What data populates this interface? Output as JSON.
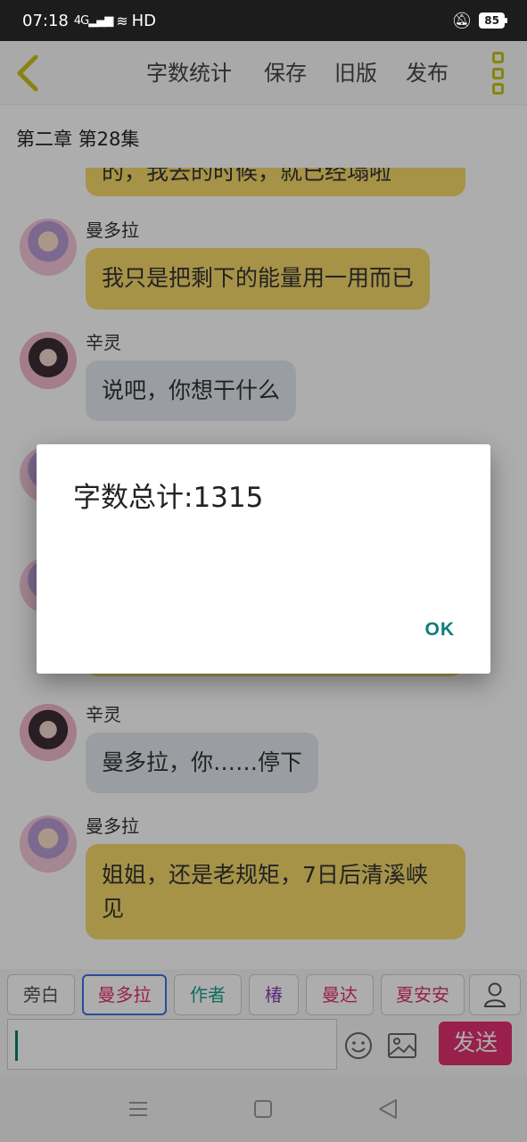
{
  "status_bar": {
    "time": "07:18",
    "signal": "4G",
    "network": "HD",
    "battery": "85"
  },
  "header": {
    "word_count": "字数统计",
    "save": "保存",
    "old_version": "旧版",
    "publish": "发布"
  },
  "chapter": {
    "title": "第二章 第28集"
  },
  "messages": [
    {
      "speaker": "",
      "text": "的，我去的时候，就已经塌啦",
      "style": "yellow"
    },
    {
      "speaker": "曼多拉",
      "text": "我只是把剩下的能量用一用而已",
      "style": "yellow"
    },
    {
      "speaker": "辛灵",
      "text": "说吧，你想干什么",
      "style": "gray"
    },
    {
      "speaker": "辛灵",
      "text": "曼多拉，你……停下",
      "style": "gray"
    },
    {
      "speaker": "曼多拉",
      "line1": "姐姐，还是老规矩，7日后清溪峡",
      "line2": "见",
      "style": "yellow"
    }
  ],
  "roles": [
    {
      "label": "旁白",
      "color": "#555555"
    },
    {
      "label": "曼多拉",
      "color": "#e0306f"
    },
    {
      "label": "作者",
      "color": "#1a9f8a"
    },
    {
      "label": "椿",
      "color": "#8a3fb5"
    },
    {
      "label": "曼达",
      "color": "#e0306f"
    },
    {
      "label": "夏安安",
      "color": "#e0306f"
    }
  ],
  "input": {
    "value": "",
    "send": "发送"
  },
  "dialog": {
    "title": "字数总计:1315",
    "ok": "OK"
  },
  "colors": {
    "accent": "#c7c31a",
    "send": "#e0306f",
    "ok": "#0e7c7b",
    "yellow_bubble": "#f5d96a",
    "gray_bubble": "#e4e8ee"
  }
}
